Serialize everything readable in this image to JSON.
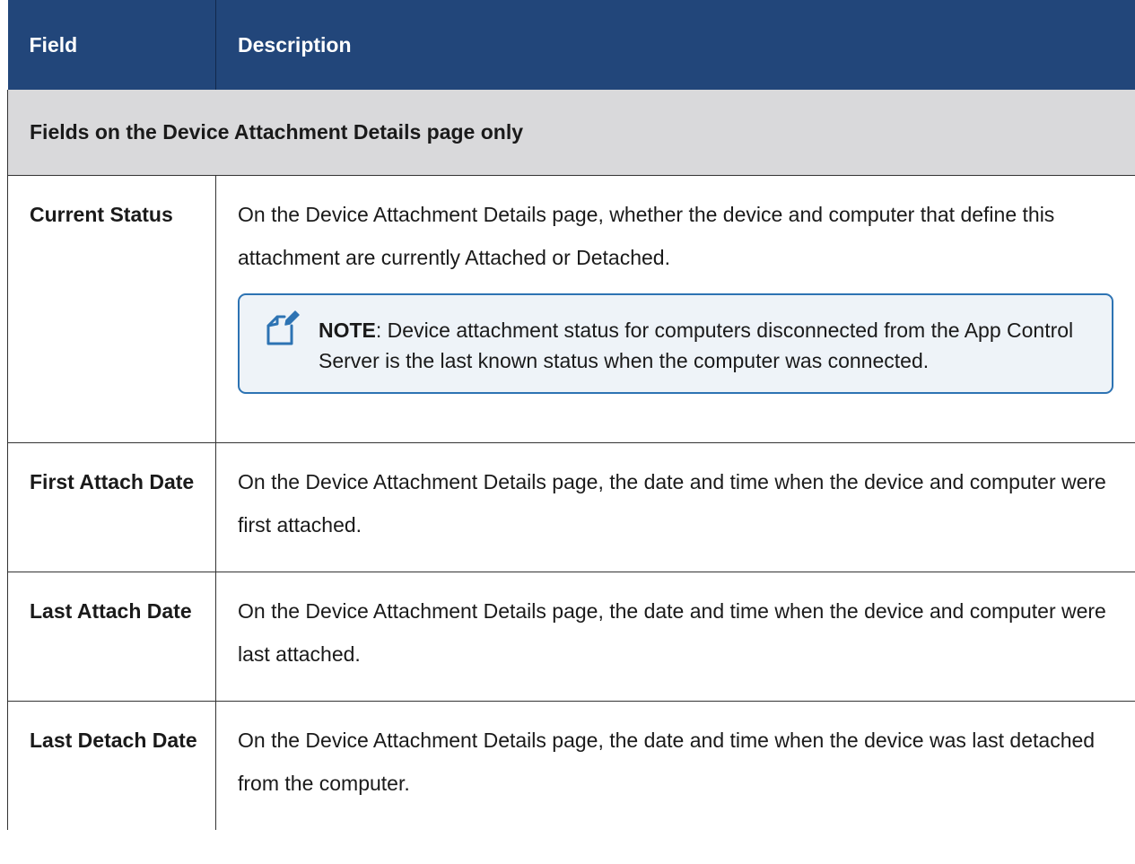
{
  "table": {
    "headers": [
      "Field",
      "Description"
    ],
    "section_title": "Fields on the Device Attachment Details page only",
    "rows": [
      {
        "field": "Current Status",
        "description": "On the Device Attachment Details page, whether the device and computer that define this attachment are currently Attached or Detached.",
        "note": {
          "label": "NOTE",
          "text": ": Device attachment status for computers disconnected from the App Control Server is the last known status when the computer was connected.",
          "icon": "note-icon"
        }
      },
      {
        "field": "First Attach Date",
        "description": "On the Device Attachment Details page, the date and time when the device and computer were first attached."
      },
      {
        "field": "Last Attach Date",
        "description": "On the Device Attachment Details page, the date and time when the device and computer were last attached."
      },
      {
        "field": "Last Detach Date",
        "description": "On the Device Attachment Details page, the date and time when the device was last detached from the computer."
      }
    ]
  },
  "colors": {
    "header_bg": "#22467a",
    "section_bg": "#d9d9db",
    "note_border": "#2d73b3",
    "note_bg": "#eef3f8"
  }
}
